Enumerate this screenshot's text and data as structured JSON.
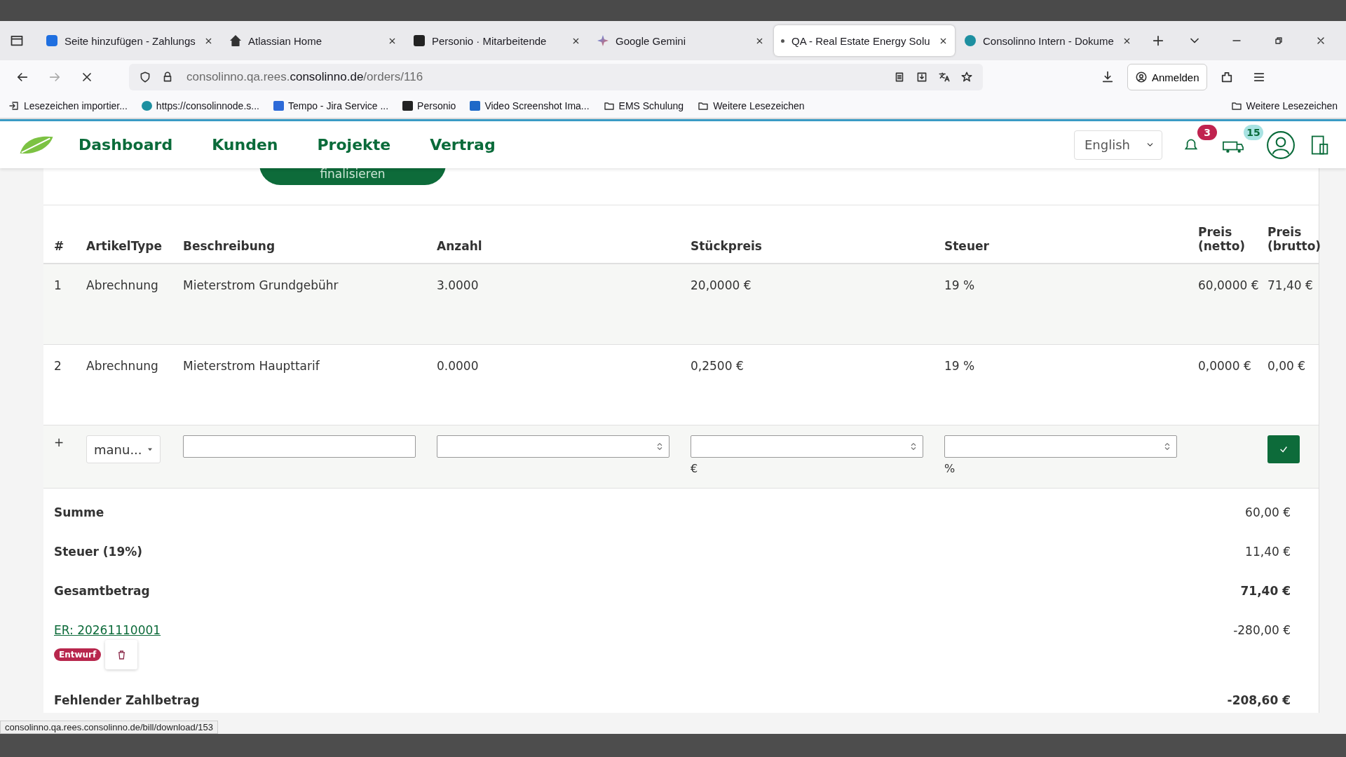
{
  "browser": {
    "tabs": [
      {
        "title": "Seite hinzufügen - Zahlungs",
        "selected": false
      },
      {
        "title": "Atlassian Home",
        "selected": false
      },
      {
        "title": "Personio · Mitarbeitende",
        "selected": false
      },
      {
        "title": "Google Gemini",
        "selected": false
      },
      {
        "title": "QA - Real Estate Energy Solu",
        "selected": true
      },
      {
        "title": "Consolinno Intern - Dokume",
        "selected": false
      }
    ],
    "url_prefix": "consolinno.qa.rees.",
    "url_domain": "consolinno.de",
    "url_path": "/orders/116",
    "sign_in": "Anmelden",
    "bookmarks": [
      "Lesezeichen importier...",
      "https://consolinnode.s...",
      "Tempo - Jira Service ...",
      "Personio",
      "Video Screenshot Ima...",
      "EMS Schulung",
      "Weitere Lesezeichen"
    ],
    "other_bookmarks": "Weitere Lesezeichen"
  },
  "app": {
    "nav": [
      "Dashboard",
      "Kunden",
      "Projekte",
      "Vertrag"
    ],
    "language": "English",
    "notifications": "3",
    "news": "15"
  },
  "finalize_button": "finalisieren",
  "table": {
    "columns": [
      "#",
      "ArtikelType",
      "Beschreibung",
      "Anzahl",
      "Stückpreis",
      "Steuer",
      "Preis (netto)",
      "Preis (brutto)"
    ],
    "rows": [
      [
        "1",
        "Abrechnung",
        "Mieterstrom Grundgebühr",
        "3.0000",
        "20,0000 €",
        "19 %",
        "60,0000 €",
        "71,40 €"
      ],
      [
        "2",
        "Abrechnung",
        "Mieterstrom Haupttarif",
        "0.0000",
        "0,2500 €",
        "19 %",
        "0,0000 €",
        "0,00 €"
      ]
    ],
    "new_row": {
      "marker": "+",
      "type": "manu...",
      "price_unit": "€",
      "tax_unit": "%"
    }
  },
  "summary": [
    {
      "label": "Summe",
      "value": "60,00 €",
      "bold_value": false
    },
    {
      "label": "Steuer (19%)",
      "value": "11,40 €",
      "bold_value": false
    },
    {
      "label": "Gesamtbetrag",
      "value": "71,40 €",
      "bold_value": true
    }
  ],
  "bill": {
    "link": "ER: 20261110001",
    "value": "-280,00 €",
    "status": "Entwurf"
  },
  "missing": {
    "label": "Fehlender Zahlbetrag",
    "value": "-208,60 €"
  },
  "status_url": "consolinno.qa.rees.consolinno.de/bill/download/153"
}
